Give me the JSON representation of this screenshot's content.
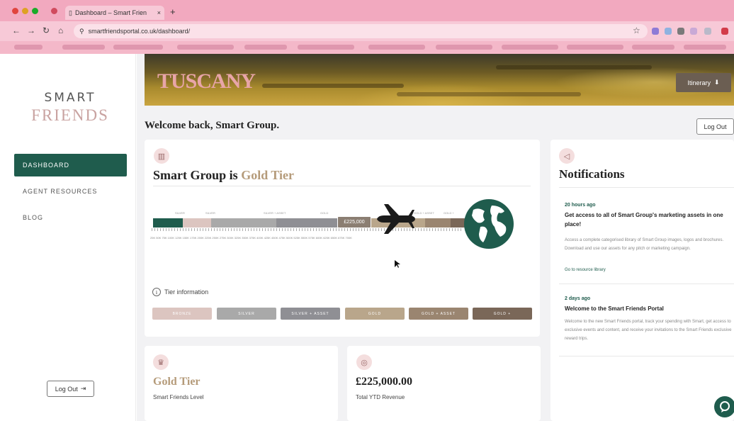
{
  "browser": {
    "tab_title": "Dashboard – Smart Frien",
    "url": "smartfriendsportal.co.uk/dashboard/"
  },
  "sidebar": {
    "logo_top": "SMART",
    "logo_bottom": "FRIENDS",
    "items": [
      {
        "label": "DASHBOARD",
        "active": true
      },
      {
        "label": "AGENT RESOURCES",
        "active": false
      },
      {
        "label": "BLOG",
        "active": false
      }
    ],
    "logout_label": "Log Out"
  },
  "hero": {
    "title": "TUSCANY",
    "itinerary_label": "Itinerary"
  },
  "welcome": "Welcome back, Smart Group.",
  "logout_label": "Log Out",
  "tier_card": {
    "heading_prefix": "Smart Group is ",
    "heading_tier": "Gold Tier",
    "current_value": "£225,000",
    "progress": 0.65,
    "segment_labels": [
      "SILVER",
      "SILVER + ASSET",
      "GOLD",
      "GOLD + ASSET",
      "GOLD +"
    ],
    "tick_labels": "25K 50K 75K 100K 125K 150K 175K 200K 225K 250K 275K 300K 325K 350K 375K 400K 425K 450K 475K 500K 525K 550K 575K 600K 625K 650K 675K 700K",
    "info_label": "Tier information",
    "tier_buttons": [
      "BRONZE",
      "SILVER",
      "SILVER + ASSET",
      "GOLD",
      "GOLD + ASSET",
      "GOLD +"
    ],
    "colors": {
      "bronze": "#dcc5c0",
      "silver": "#a9a9a9",
      "silver_asset": "#8f8f94",
      "gold": "#b9a68b",
      "gold_asset": "#9a8570",
      "gold_plus": "#7a6758",
      "accent_green": "#1f5c4d"
    }
  },
  "notifications": {
    "title": "Notifications",
    "items": [
      {
        "time": "20 hours ago",
        "heading": "Get access to all of Smart Group's marketing assets in one place!",
        "body": "Access a complete categorised library of Smart Group images, logos and brochures. Download and use our assets for any pitch or marketing campaign.",
        "link": "Go to resource library"
      },
      {
        "time": "2 days ago",
        "heading": "Welcome to the Smart Friends Portal",
        "body": "Welcome to the new Smart Friends portal, track your spending with Smart, get access to exclusive events and content, and receive your invitations to the Smart Friends exclusive reward trips."
      }
    ]
  },
  "stats": {
    "level_value": "Gold Tier",
    "level_label": "Smart Friends Level",
    "revenue_value": "£225,000.00",
    "revenue_label": "Total YTD Revenue"
  }
}
